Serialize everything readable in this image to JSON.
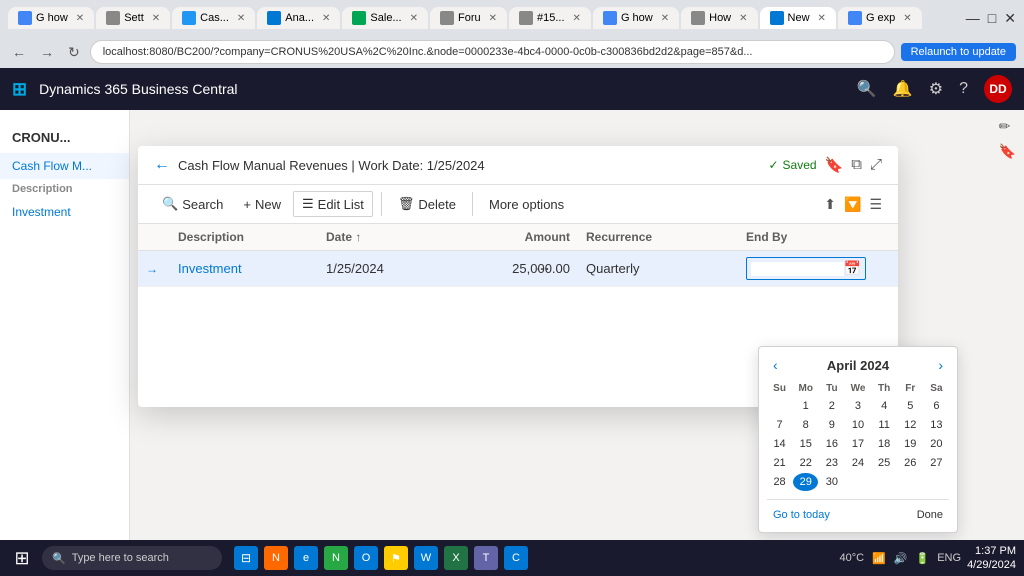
{
  "browser": {
    "tabs": [
      {
        "label": "G how",
        "active": false,
        "color": "#4285f4"
      },
      {
        "label": "Sett",
        "active": false,
        "color": "#888"
      },
      {
        "label": "Cas...",
        "active": false,
        "color": "#2196f3"
      },
      {
        "label": "Ana...",
        "active": false,
        "color": "#0078d4"
      },
      {
        "label": "Sale...",
        "active": false,
        "color": "#00a651"
      },
      {
        "label": "Foru",
        "active": false,
        "color": "#888"
      },
      {
        "label": "#15..",
        "active": false,
        "color": "#888"
      },
      {
        "label": "G how",
        "active": false,
        "color": "#4285f4"
      },
      {
        "label": "How",
        "active": false,
        "color": "#888"
      },
      {
        "label": "New",
        "active": true,
        "color": "#0078d4"
      },
      {
        "label": "G exp",
        "active": false,
        "color": "#4285f4"
      }
    ],
    "address": "localhost:8080/BC200/?company=CRONUS%20USA%2C%20Inc.&node=0000233e-4bc4-0000-0c0b-c300836bd2d2&page=857&d...",
    "relaunch_label": "Relaunch to update"
  },
  "d365": {
    "app_title": "Dynamics 365 Business Central",
    "avatar_initials": "DD"
  },
  "page": {
    "company_short": "CRONU...",
    "section": "Cash Flow M...",
    "col_header": "Description"
  },
  "modal": {
    "title": "Cash Flow Manual Revenues | Work Date: 1/25/2024",
    "saved_label": "Saved",
    "toolbar": {
      "search_label": "Search",
      "new_label": "New",
      "edit_list_label": "Edit List",
      "delete_label": "Delete",
      "more_options_label": "More options"
    },
    "table": {
      "columns": [
        "",
        "Description",
        "Date",
        "Amount",
        "Recurrence",
        "End By"
      ],
      "rows": [
        {
          "arrow": "→",
          "description": "Investment",
          "date": "1/25/2024",
          "amount": "25,000.00",
          "recurrence": "Quarterly",
          "end_by": ""
        }
      ]
    }
  },
  "calendar": {
    "month_year": "April 2024",
    "day_headers": [
      "Su",
      "Mo",
      "Tu",
      "We",
      "Th",
      "Fr",
      "Sa"
    ],
    "weeks": [
      [
        "",
        "1",
        "2",
        "3",
        "4",
        "5",
        "6"
      ],
      [
        "7",
        "8",
        "9",
        "10",
        "11",
        "12",
        "13"
      ],
      [
        "14",
        "15",
        "16",
        "17",
        "18",
        "19",
        "20"
      ],
      [
        "21",
        "22",
        "23",
        "24",
        "25",
        "26",
        "27"
      ],
      [
        "28",
        "29",
        "30",
        "",
        "",
        "",
        ""
      ]
    ],
    "today_day": "29",
    "go_to_today_label": "Go to today",
    "done_label": "Done"
  },
  "taskbar": {
    "search_placeholder": "Type here to search",
    "time": "1:37 PM",
    "date": "4/29/2024",
    "temp": "40°C",
    "input_locale": "ENG"
  }
}
